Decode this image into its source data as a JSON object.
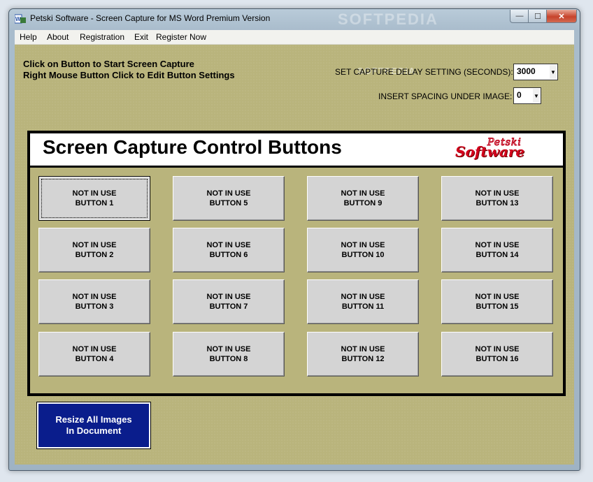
{
  "window": {
    "title": "Petski Software -  Screen Capture for MS Word Premium Version",
    "watermark": "SOFTPEDIA",
    "controls": {
      "minimize": "—",
      "maximize": "☐",
      "close": "✕"
    }
  },
  "menu": {
    "items": [
      "Help",
      "About",
      "Registration",
      "Exit",
      "Register Now"
    ]
  },
  "instructions": {
    "line1": "Click on Button to Start Screen Capture",
    "line2": "Right Mouse Button Click to Edit Button Settings"
  },
  "settings": {
    "delay_label": "SET CAPTURE DELAY SETTING (SECONDS):",
    "delay_value": "3000",
    "spacing_label": "INSERT SPACING UNDER IMAGE:",
    "spacing_value": "0",
    "watermark": "SOFTPEDIA"
  },
  "panel": {
    "title": "Screen Capture Control Buttons",
    "logo_top": "Petski",
    "logo_bottom": "Software"
  },
  "buttons": [
    "NOT IN USE\nBUTTON 1",
    "NOT IN USE\nBUTTON 2",
    "NOT IN USE\nBUTTON 3",
    "NOT IN USE\nBUTTON 4",
    "NOT IN USE\nBUTTON 5",
    "NOT IN USE\nBUTTON 6",
    "NOT IN USE\nBUTTON 7",
    "NOT IN USE\nBUTTON 8",
    "NOT IN USE\nBUTTON 9",
    "NOT IN USE\nBUTTON 10",
    "NOT IN USE\nBUTTON 11",
    "NOT IN USE\nBUTTON 12",
    "NOT IN USE\nBUTTON 13",
    "NOT IN USE\nBUTTON 14",
    "NOT IN USE\nBUTTON 15",
    "NOT IN USE\nBUTTON 16"
  ],
  "resize_button": "Resize All Images\nIn Document",
  "colors": {
    "background": "#b9b47c",
    "resize_button": "#0a1d8c",
    "logo_red": "#d4001c"
  }
}
